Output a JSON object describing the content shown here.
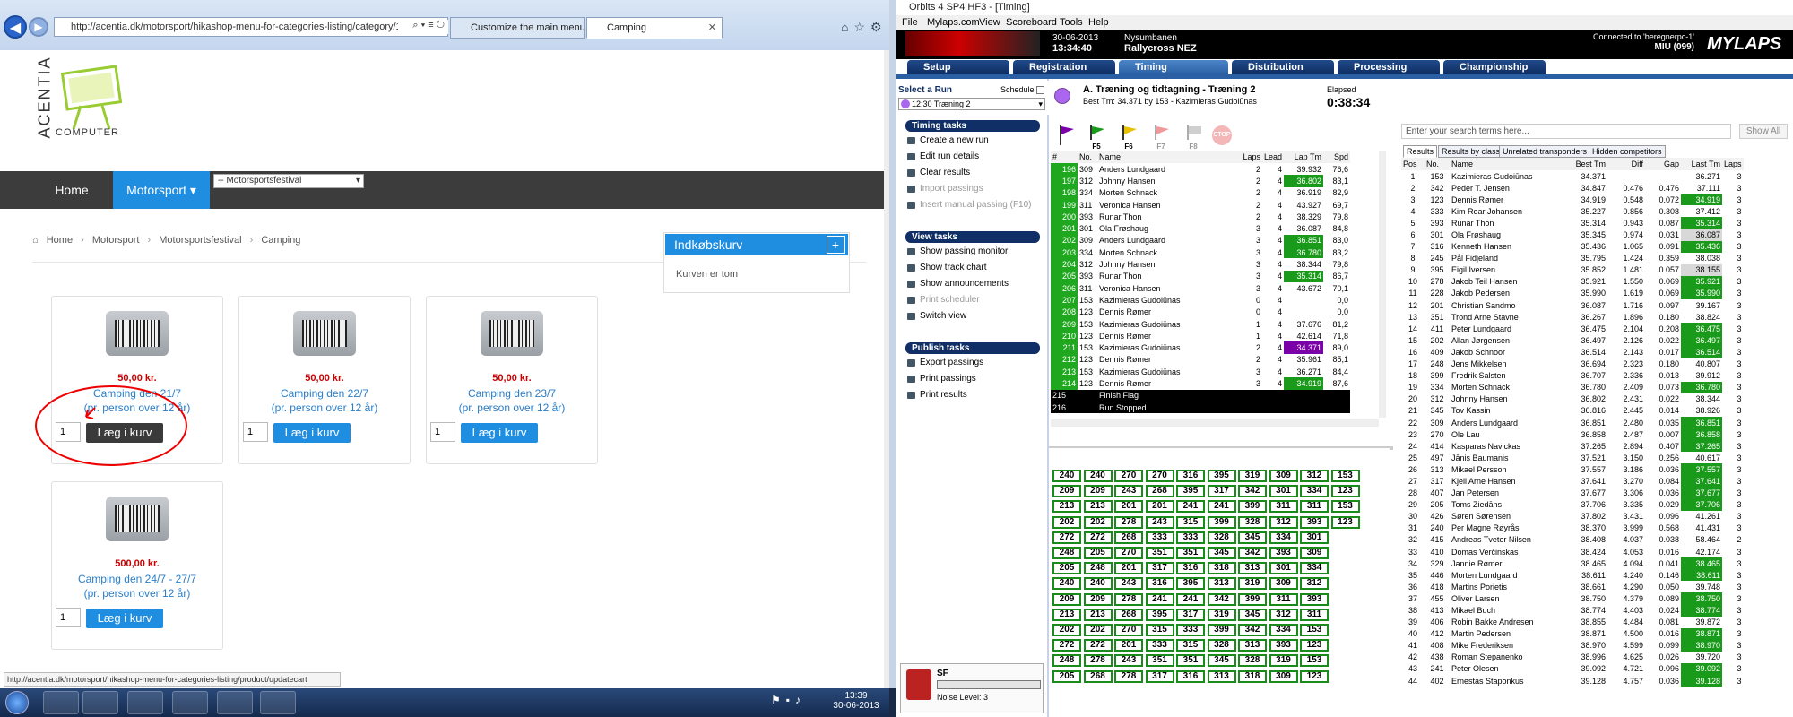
{
  "browser": {
    "url": "http://acentia.dk/motorsport/hikashop-menu-for-categories-listing/category/12-campi",
    "tabs": [
      {
        "label": "Customize the main menu..."
      },
      {
        "label": "Camping"
      }
    ],
    "logo_text": "ACENTIA",
    "logo_sub": "COMPUTER",
    "nav": {
      "home": "Home",
      "motorsport": "Motorsport ▾",
      "select_value": "-- Motorsportsfestival"
    },
    "breadcrumb": [
      "Home",
      "Motorsport",
      "Motorsportsfestival",
      "Camping"
    ],
    "products": [
      {
        "price": "50,00 kr.",
        "title1": "Camping den 21/7",
        "title2": "(pr. person over 12 år)",
        "qty": "1",
        "btn": "Læg i kurv"
      },
      {
        "price": "50,00 kr.",
        "title1": "Camping den 22/7",
        "title2": "(pr. person over 12 år)",
        "qty": "1",
        "btn": "Læg i kurv"
      },
      {
        "price": "50,00 kr.",
        "title1": "Camping den 23/7",
        "title2": "(pr. person over 12 år)",
        "qty": "1",
        "btn": "Læg i kurv"
      },
      {
        "price": "500,00 kr.",
        "title1": "Camping den 24/7 - 27/7",
        "title2": "(pr. person over 12 år)",
        "qty": "1",
        "btn": "Læg i kurv"
      }
    ],
    "cart": {
      "title": "Indkøbskurv",
      "plus": "+",
      "empty": "Kurven er tom"
    },
    "status_url": "http://acentia.dk/motorsport/hikashop-menu-for-categories-listing/product/updatecart"
  },
  "taskbar": {
    "time": "13:39",
    "date": "30-06-2013"
  },
  "app": {
    "title": "Orbits 4 SP4 HF3 - [Timing]",
    "menu": [
      "File",
      "Mylaps.com",
      "View",
      "Scoreboard",
      "Tools",
      "Help"
    ],
    "banner": {
      "date": "30-06-2013",
      "time": "13:34:40",
      "event": "Nysumbanen",
      "session": "Rallycross NEZ",
      "connected": "Connected to 'beregnerpc-1'",
      "device": "MIU (099)",
      "brand": "MYLAPS"
    },
    "tabs": [
      "Setup",
      "Registration",
      "Timing",
      "Distribution",
      "Processing",
      "Championship"
    ],
    "select_run": "Select a Run",
    "schedule": "Schedule",
    "run_value": "12:30  Træning 2",
    "timing_tasks": {
      "head": "Timing tasks",
      "items": [
        "Create a new run",
        "Edit run details",
        "Clear results",
        "Import passings",
        "Insert manual passing (F10)"
      ]
    },
    "view_tasks": {
      "head": "View tasks",
      "items": [
        "Show passing monitor",
        "Show track chart",
        "Show announcements",
        "Print scheduler",
        "Switch view"
      ]
    },
    "publish_tasks": {
      "head": "Publish tasks",
      "items": [
        "Export passings",
        "Print passings",
        "Print results"
      ]
    },
    "run_title": "A. Træning og tidtagning - Træning 2",
    "best_tm": "Best Tm: 34.371 by 153 - Kazimieras Gudoiūnas",
    "elapsed_label": "Elapsed",
    "elapsed": "0:38:34",
    "flag_keys": [
      "F5",
      "F6",
      "F7",
      "F8"
    ],
    "stop": "STOP",
    "passing_headers": [
      "#",
      "No.",
      "Name",
      "Laps",
      "Lead",
      "Lap Tm",
      "Spd"
    ],
    "passings": [
      [
        "196",
        "309",
        "Anders Lundgaard",
        "2",
        "4",
        "39.932",
        "76,6"
      ],
      [
        "197",
        "312",
        "Johnny Hansen",
        "2",
        "4",
        "36.802",
        "83,1"
      ],
      [
        "198",
        "334",
        "Morten Schnack",
        "2",
        "4",
        "36.919",
        "82,9"
      ],
      [
        "199",
        "311",
        "Veronica Hansen",
        "2",
        "4",
        "43.927",
        "69,7"
      ],
      [
        "200",
        "393",
        "Runar Thon",
        "2",
        "4",
        "38.329",
        "79,8"
      ],
      [
        "201",
        "301",
        "Ola Frøshaug",
        "3",
        "4",
        "36.087",
        "84,8"
      ],
      [
        "202",
        "309",
        "Anders Lundgaard",
        "3",
        "4",
        "36.851",
        "83,0"
      ],
      [
        "203",
        "334",
        "Morten Schnack",
        "3",
        "4",
        "36.780",
        "83,2"
      ],
      [
        "204",
        "312",
        "Johnny Hansen",
        "3",
        "4",
        "38.344",
        "79,8"
      ],
      [
        "205",
        "393",
        "Runar Thon",
        "3",
        "4",
        "35.314",
        "86,7"
      ],
      [
        "206",
        "311",
        "Veronica Hansen",
        "3",
        "4",
        "43.672",
        "70,1"
      ],
      [
        "207",
        "153",
        "Kazimieras Gudoiūnas",
        "0",
        "4",
        "",
        "0,0"
      ],
      [
        "208",
        "123",
        "Dennis Rømer",
        "0",
        "4",
        "",
        "0,0"
      ],
      [
        "209",
        "153",
        "Kazimieras Gudoiūnas",
        "1",
        "4",
        "37.676",
        "81,2"
      ],
      [
        "210",
        "123",
        "Dennis Rømer",
        "1",
        "4",
        "42.614",
        "71,8"
      ],
      [
        "211",
        "153",
        "Kazimieras Gudoiūnas",
        "2",
        "4",
        "34.371",
        "89,0"
      ],
      [
        "212",
        "123",
        "Dennis Rømer",
        "2",
        "4",
        "35.961",
        "85,1"
      ],
      [
        "213",
        "153",
        "Kazimieras Gudoiūnas",
        "3",
        "4",
        "36.271",
        "84,4"
      ],
      [
        "214",
        "123",
        "Dennis Rømer",
        "3",
        "4",
        "34.919",
        "87,6"
      ],
      [
        "215",
        "",
        "Finish Flag",
        "",
        "",
        "",
        ""
      ],
      [
        "216",
        "",
        "Run Stopped",
        "",
        "",
        "",
        ""
      ]
    ],
    "pass_counter": "213",
    "pass_grid": [
      [
        "240",
        "240",
        "270",
        "270",
        "316",
        "395",
        "319",
        "309",
        "312",
        "153"
      ],
      [
        "209",
        "209",
        "243",
        "268",
        "395",
        "317",
        "342",
        "301",
        "334",
        "123"
      ],
      [
        "213",
        "213",
        "201",
        "201",
        "241",
        "241",
        "399",
        "311",
        "311",
        "153"
      ],
      [
        "202",
        "202",
        "278",
        "243",
        "315",
        "399",
        "328",
        "312",
        "393",
        "123"
      ],
      [
        "272",
        "272",
        "268",
        "333",
        "333",
        "328",
        "345",
        "334",
        "301",
        ""
      ],
      [
        "248",
        "205",
        "270",
        "351",
        "351",
        "345",
        "342",
        "393",
        "309",
        ""
      ],
      [
        "205",
        "248",
        "201",
        "317",
        "316",
        "318",
        "313",
        "301",
        "334",
        ""
      ],
      [
        "240",
        "240",
        "243",
        "316",
        "395",
        "313",
        "319",
        "309",
        "312",
        ""
      ],
      [
        "209",
        "209",
        "278",
        "241",
        "241",
        "342",
        "399",
        "311",
        "393",
        ""
      ],
      [
        "213",
        "213",
        "268",
        "395",
        "317",
        "319",
        "345",
        "312",
        "311",
        ""
      ],
      [
        "202",
        "202",
        "270",
        "315",
        "333",
        "399",
        "342",
        "334",
        "153",
        ""
      ],
      [
        "272",
        "272",
        "201",
        "333",
        "315",
        "328",
        "313",
        "393",
        "123",
        ""
      ],
      [
        "248",
        "278",
        "243",
        "351",
        "351",
        "345",
        "328",
        "319",
        "153",
        ""
      ],
      [
        "205",
        "268",
        "278",
        "317",
        "316",
        "313",
        "318",
        "309",
        "123",
        ""
      ]
    ],
    "sf_label": "SF",
    "noise": "Noise Level: 3",
    "search_placeholder": "Enter your search terms here...",
    "show_all": "Show All",
    "result_tabs": [
      "Results",
      "Results by class",
      "Unrelated transponders",
      "Hidden competitors"
    ],
    "result_headers": [
      "Pos",
      "No.",
      "Name",
      "Best Tm",
      "Diff",
      "Gap",
      "Last Tm",
      "Laps"
    ],
    "results": [
      [
        "1",
        "153",
        "Kazimieras Gudoiūnas",
        "34.371",
        "",
        "",
        "36.271",
        "3"
      ],
      [
        "2",
        "342",
        "Peder T. Jensen",
        "34.847",
        "0.476",
        "0.476",
        "37.111",
        "3"
      ],
      [
        "3",
        "123",
        "Dennis Rømer",
        "34.919",
        "0.548",
        "0.072",
        "34.919",
        "3"
      ],
      [
        "4",
        "333",
        "Kim Roar Johansen",
        "35.227",
        "0.856",
        "0.308",
        "37.412",
        "3"
      ],
      [
        "5",
        "393",
        "Runar Thon",
        "35.314",
        "0.943",
        "0.087",
        "35.314",
        "3"
      ],
      [
        "6",
        "301",
        "Ola Frøshaug",
        "35.345",
        "0.974",
        "0.031",
        "36.087",
        "3"
      ],
      [
        "7",
        "316",
        "Kenneth Hansen",
        "35.436",
        "1.065",
        "0.091",
        "35.436",
        "3"
      ],
      [
        "8",
        "245",
        "Pål Fidjeland",
        "35.795",
        "1.424",
        "0.359",
        "38.038",
        "3"
      ],
      [
        "9",
        "395",
        "Eigil Iversen",
        "35.852",
        "1.481",
        "0.057",
        "38.155",
        "3"
      ],
      [
        "10",
        "278",
        "Jakob Teil Hansen",
        "35.921",
        "1.550",
        "0.069",
        "35.921",
        "3"
      ],
      [
        "11",
        "228",
        "Jakob Pedersen",
        "35.990",
        "1.619",
        "0.069",
        "35.990",
        "3"
      ],
      [
        "12",
        "201",
        "Christian Sandmo",
        "36.087",
        "1.716",
        "0.097",
        "39.167",
        "3"
      ],
      [
        "13",
        "351",
        "Trond Arne Stavne",
        "36.267",
        "1.896",
        "0.180",
        "38.824",
        "3"
      ],
      [
        "14",
        "411",
        "Peter Lundgaard",
        "36.475",
        "2.104",
        "0.208",
        "36.475",
        "3"
      ],
      [
        "15",
        "202",
        "Allan Jørgensen",
        "36.497",
        "2.126",
        "0.022",
        "36.497",
        "3"
      ],
      [
        "16",
        "409",
        "Jakob Schnoor",
        "36.514",
        "2.143",
        "0.017",
        "36.514",
        "3"
      ],
      [
        "17",
        "248",
        "Jens Mikkelsen",
        "36.694",
        "2.323",
        "0.180",
        "40.807",
        "3"
      ],
      [
        "18",
        "399",
        "Fredrik Salsten",
        "36.707",
        "2.336",
        "0.013",
        "39.912",
        "3"
      ],
      [
        "19",
        "334",
        "Morten Schnack",
        "36.780",
        "2.409",
        "0.073",
        "36.780",
        "3"
      ],
      [
        "20",
        "312",
        "Johnny Hansen",
        "36.802",
        "2.431",
        "0.022",
        "38.344",
        "3"
      ],
      [
        "21",
        "345",
        "Tov Kassin",
        "36.816",
        "2.445",
        "0.014",
        "38.926",
        "3"
      ],
      [
        "22",
        "309",
        "Anders Lundgaard",
        "36.851",
        "2.480",
        "0.035",
        "36.851",
        "3"
      ],
      [
        "23",
        "270",
        "Ole Lau",
        "36.858",
        "2.487",
        "0.007",
        "36.858",
        "3"
      ],
      [
        "24",
        "414",
        "Kasparas Navickas",
        "37.265",
        "2.894",
        "0.407",
        "37.265",
        "3"
      ],
      [
        "25",
        "497",
        "Jānis Baumanis",
        "37.521",
        "3.150",
        "0.256",
        "40.617",
        "3"
      ],
      [
        "26",
        "313",
        "Mikael Persson",
        "37.557",
        "3.186",
        "0.036",
        "37.557",
        "3"
      ],
      [
        "27",
        "317",
        "Kjell Arne Hansen",
        "37.641",
        "3.270",
        "0.084",
        "37.641",
        "3"
      ],
      [
        "28",
        "407",
        "Jan Petersen",
        "37.677",
        "3.306",
        "0.036",
        "37.677",
        "3"
      ],
      [
        "29",
        "205",
        "Toms Ziedāns",
        "37.706",
        "3.335",
        "0.029",
        "37.706",
        "3"
      ],
      [
        "30",
        "426",
        "Søren Sørensen",
        "37.802",
        "3.431",
        "0.096",
        "41.261",
        "3"
      ],
      [
        "31",
        "240",
        "Per Magne Røyrås",
        "38.370",
        "3.999",
        "0.568",
        "41.431",
        "3"
      ],
      [
        "32",
        "415",
        "Andreas Tveter Nilsen",
        "38.408",
        "4.037",
        "0.038",
        "58.464",
        "2"
      ],
      [
        "33",
        "410",
        "Domas Verčinskas",
        "38.424",
        "4.053",
        "0.016",
        "42.174",
        "3"
      ],
      [
        "34",
        "329",
        "Jannie Rømer",
        "38.465",
        "4.094",
        "0.041",
        "38.465",
        "3"
      ],
      [
        "35",
        "446",
        "Morten Lundgaard",
        "38.611",
        "4.240",
        "0.146",
        "38.611",
        "3"
      ],
      [
        "36",
        "418",
        "Martins Porietis",
        "38.661",
        "4.290",
        "0.050",
        "39.748",
        "3"
      ],
      [
        "37",
        "455",
        "Oliver Larsen",
        "38.750",
        "4.379",
        "0.089",
        "38.750",
        "3"
      ],
      [
        "38",
        "413",
        "Mikael Buch",
        "38.774",
        "4.403",
        "0.024",
        "38.774",
        "3"
      ],
      [
        "39",
        "406",
        "Robin Bakke Andresen",
        "38.855",
        "4.484",
        "0.081",
        "39.872",
        "3"
      ],
      [
        "40",
        "412",
        "Martin Pedersen",
        "38.871",
        "4.500",
        "0.016",
        "38.871",
        "3"
      ],
      [
        "41",
        "408",
        "Mike Frederiksen",
        "38.970",
        "4.599",
        "0.099",
        "38.970",
        "3"
      ],
      [
        "42",
        "438",
        "Roman Stepanenko",
        "38.996",
        "4.625",
        "0.026",
        "39.720",
        "3"
      ],
      [
        "43",
        "241",
        "Peter Olesen",
        "39.092",
        "4.721",
        "0.096",
        "39.092",
        "3"
      ],
      [
        "44",
        "402",
        "Ernestas Staponkus",
        "39.128",
        "4.757",
        "0.036",
        "39.128",
        "3"
      ]
    ]
  },
  "colors": {
    "accent_blue": "#1f8de0",
    "timing_green": "#1a9a1a",
    "best_purple": "#7a00a8",
    "nav_dark": "#3c3c3c",
    "app_tab": "#0e2d61"
  }
}
